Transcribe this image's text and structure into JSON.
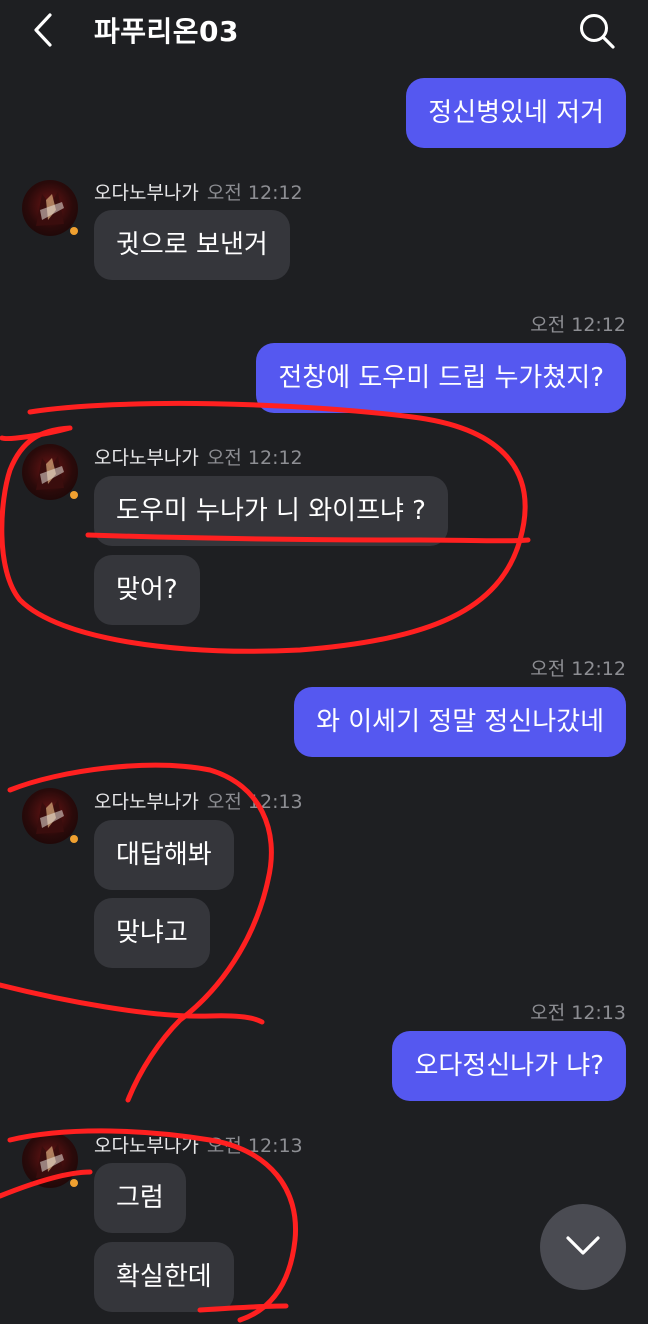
{
  "header": {
    "title": "파푸리온03",
    "back_icon": "chevron-left-icon",
    "search_icon": "search-icon"
  },
  "messages": [
    {
      "side": "me",
      "text": "정신병있네 저거",
      "time": ""
    },
    {
      "side": "other",
      "sender": "오다노부나가",
      "time": "오전 12:12",
      "text": "귓으로 보낸거"
    },
    {
      "side": "me",
      "time": "오전 12:12",
      "text": "전창에 도우미 드립 누가쳤지?"
    },
    {
      "side": "other",
      "sender": "오다노부나가",
      "time": "오전 12:12",
      "text": "도우미 누나가 니 와이프냐 ?"
    },
    {
      "side": "other",
      "text": "맞어?"
    },
    {
      "side": "me",
      "time": "오전 12:12",
      "text": "와 이세기 정말 정신나갔네"
    },
    {
      "side": "other",
      "sender": "오다노부나가",
      "time": "오전 12:13",
      "text": "대답해봐"
    },
    {
      "side": "other",
      "text": "맞냐고"
    },
    {
      "side": "me",
      "time": "오전 12:13",
      "text": "오다정신나가 냐?"
    },
    {
      "side": "other",
      "sender": "오다노부나가",
      "time": "오전 12:13",
      "text": "그럼"
    },
    {
      "side": "other",
      "text": "확실한데"
    }
  ],
  "colors": {
    "background": "#1e1f22",
    "my_bubble": "#5558f0",
    "other_bubble": "#35363b",
    "annotation": "#ff2020"
  },
  "scroll_button_icon": "chevron-down-icon"
}
